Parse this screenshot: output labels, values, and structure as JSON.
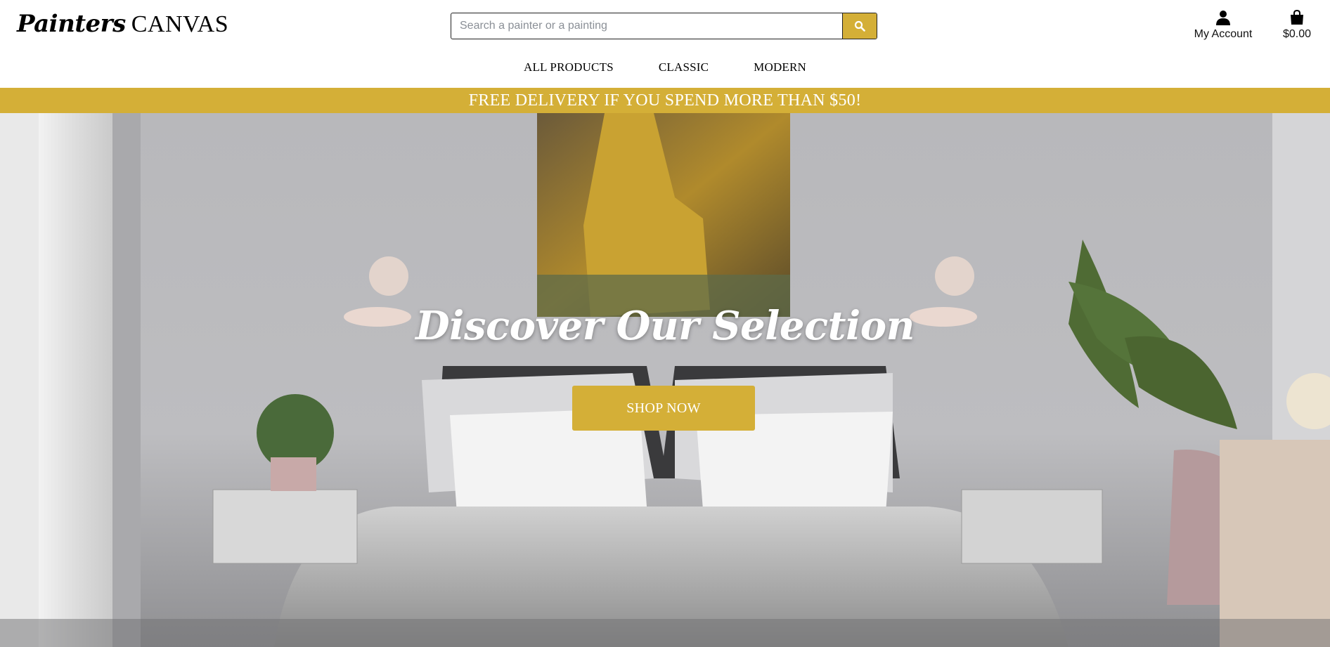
{
  "brand": {
    "script": "Painters",
    "plain": "CANVAS"
  },
  "search": {
    "placeholder": "Search a painter or a painting",
    "button_icon": "search-icon"
  },
  "account": {
    "label": "My Account",
    "icon": "user-icon"
  },
  "cart": {
    "total": "$0.00",
    "icon": "shopping-bag-icon"
  },
  "nav": {
    "items": [
      {
        "label": "ALL PRODUCTS"
      },
      {
        "label": "CLASSIC"
      },
      {
        "label": "MODERN"
      }
    ]
  },
  "banner": {
    "text": "FREE DELIVERY IF YOU SPEND MORE THAN $50!"
  },
  "hero": {
    "title": "Discover Our Selection",
    "cta": "SHOP NOW"
  },
  "colors": {
    "accent": "#d4af37",
    "text": "#000000",
    "background": "#ffffff"
  }
}
